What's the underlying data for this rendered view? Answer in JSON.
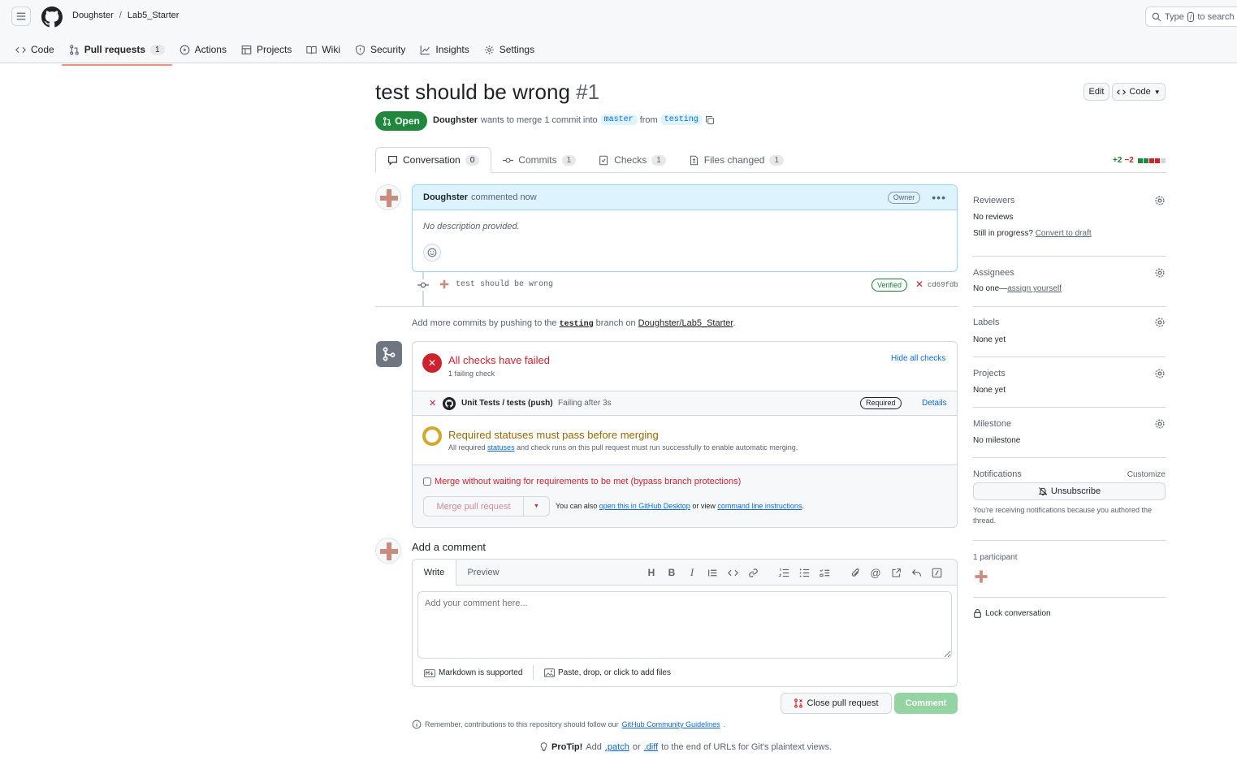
{
  "header": {
    "owner": "Doughster",
    "sep": "/",
    "repo": "Lab5_Starter",
    "search_prefix": "Type",
    "search_key": "/",
    "search_suffix": "to search"
  },
  "repo_tabs": [
    {
      "label": "Code"
    },
    {
      "label": "Pull requests",
      "count": "1"
    },
    {
      "label": "Actions"
    },
    {
      "label": "Projects"
    },
    {
      "label": "Wiki"
    },
    {
      "label": "Security"
    },
    {
      "label": "Insights"
    },
    {
      "label": "Settings"
    }
  ],
  "pr": {
    "title": "test should be wrong",
    "number": "#1",
    "edit_label": "Edit",
    "code_label": "Code",
    "state": "Open",
    "author": "Doughster",
    "merge_text": "wants to merge 1 commit into",
    "base": "master",
    "from": "from",
    "head": "testing"
  },
  "pr_tabs": [
    {
      "label": "Conversation",
      "count": "0"
    },
    {
      "label": "Commits",
      "count": "1"
    },
    {
      "label": "Checks",
      "count": "1"
    },
    {
      "label": "Files changed",
      "count": "1"
    }
  ],
  "diffstat": {
    "additions": "+2",
    "deletions": "−2"
  },
  "comment": {
    "author": "Doughster",
    "time": "commented now",
    "badge": "Owner",
    "body": "No description provided."
  },
  "commit": {
    "message": "test should be wrong",
    "verified": "Verified",
    "sha": "cd69fdb"
  },
  "push_hint": {
    "pre": "Add more commits by pushing to the",
    "branch": "testing",
    "mid": "branch on",
    "repo": "Doughster/Lab5_Starter",
    "end": "."
  },
  "checks": {
    "title": "All checks have failed",
    "subtitle": "1 failing check",
    "hide": "Hide all checks",
    "item_name": "Unit Tests / tests (push)",
    "item_status": "Failing after 3s",
    "required": "Required",
    "details": "Details",
    "req_title": "Required statuses must pass before merging",
    "req_pre": "All required",
    "req_link": "statuses",
    "req_post": "and check runs on this pull request must run successfully to enable automatic merging.",
    "bypass": "Merge without waiting for requirements to be met (bypass branch protections)",
    "merge_button": "Merge pull request",
    "also_pre": "You can also",
    "also_link1": "open this in GitHub Desktop",
    "also_mid": "or view",
    "also_link2": "command line instructions",
    "also_end": "."
  },
  "add_comment": {
    "heading": "Add a comment",
    "write_tab": "Write",
    "preview_tab": "Preview",
    "placeholder": "Add your comment here...",
    "markdown": "Markdown is supported",
    "attach": "Paste, drop, or click to add files",
    "close_button": "Close pull request",
    "comment_button": "Comment"
  },
  "footer": {
    "remember_pre": "Remember, contributions to this repository should follow our",
    "guidelines": "GitHub Community Guidelines",
    "remember_end": ".",
    "protip": "ProTip!",
    "tip_add": "Add",
    "patch": ".patch",
    "or": "or",
    "diff": ".diff",
    "tip_end": "to the end of URLs for Git's plaintext views."
  },
  "sidebar": {
    "reviewers": {
      "title": "Reviewers",
      "value": "No reviews",
      "progress": "Still in progress?",
      "draft_link": "Convert to draft"
    },
    "assignees": {
      "title": "Assignees",
      "value": "No one—",
      "link": "assign yourself"
    },
    "labels": {
      "title": "Labels",
      "value": "None yet"
    },
    "projects": {
      "title": "Projects",
      "value": "None yet"
    },
    "milestone": {
      "title": "Milestone",
      "value": "No milestone"
    },
    "notifications": {
      "title": "Notifications",
      "customize": "Customize",
      "button": "Unsubscribe",
      "note": "You're receiving notifications because you authored the thread."
    },
    "participants": {
      "title": "1 participant"
    },
    "lock": "Lock conversation"
  },
  "colors": {
    "accent": "#0969da",
    "open": "#1f883d",
    "danger": "#cf222e",
    "attention": "#9a6700"
  }
}
